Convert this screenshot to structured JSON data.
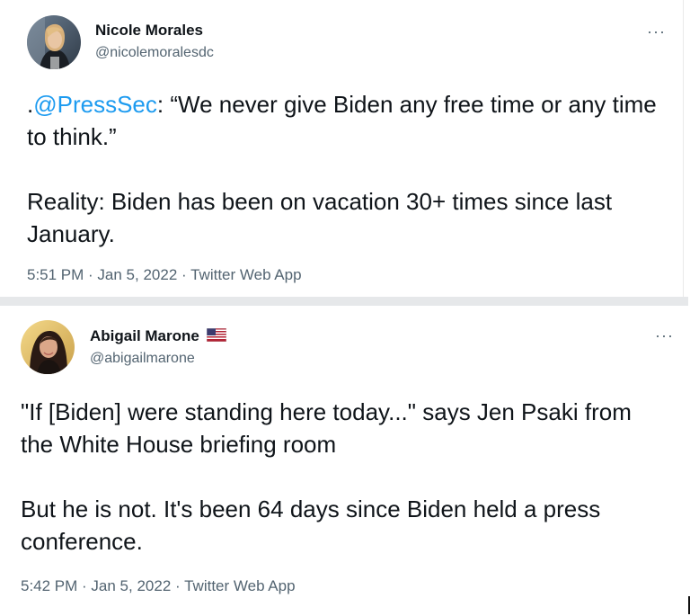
{
  "tweets": [
    {
      "display_name": "Nicole Morales",
      "handle": "@nicolemoralesdc",
      "more": "···",
      "text": {
        "lead": ".",
        "mention": "@PressSec",
        "line1_rest": ": “We never give Biden any free time or any time to think.”",
        "paragraph2": "Reality: Biden has been on vacation 30+ times since last January."
      },
      "time": "5:51 PM",
      "date": "Jan 5, 2022",
      "source": "Twitter Web App",
      "separator": " · "
    },
    {
      "display_name": "Abigail Marone",
      "handle": "@abigailmarone",
      "more": "···",
      "has_flag": true,
      "text": {
        "paragraph1": "\"If [Biden] were standing here today...\" says Jen Psaki from the White House briefing room",
        "paragraph2": "But he is not. It's been 64 days since Biden held a press conference."
      },
      "time": "5:42 PM",
      "date": "Jan 5, 2022",
      "source": "Twitter Web App",
      "separator": " · "
    }
  ],
  "colors": {
    "text_primary": "#0f1419",
    "text_secondary": "#536471",
    "link_blue": "#1d9bf0",
    "divider_gray": "#e6e8ea"
  },
  "icons": {
    "more": "more-horizontal-icon",
    "flag": "us-flag-icon"
  }
}
